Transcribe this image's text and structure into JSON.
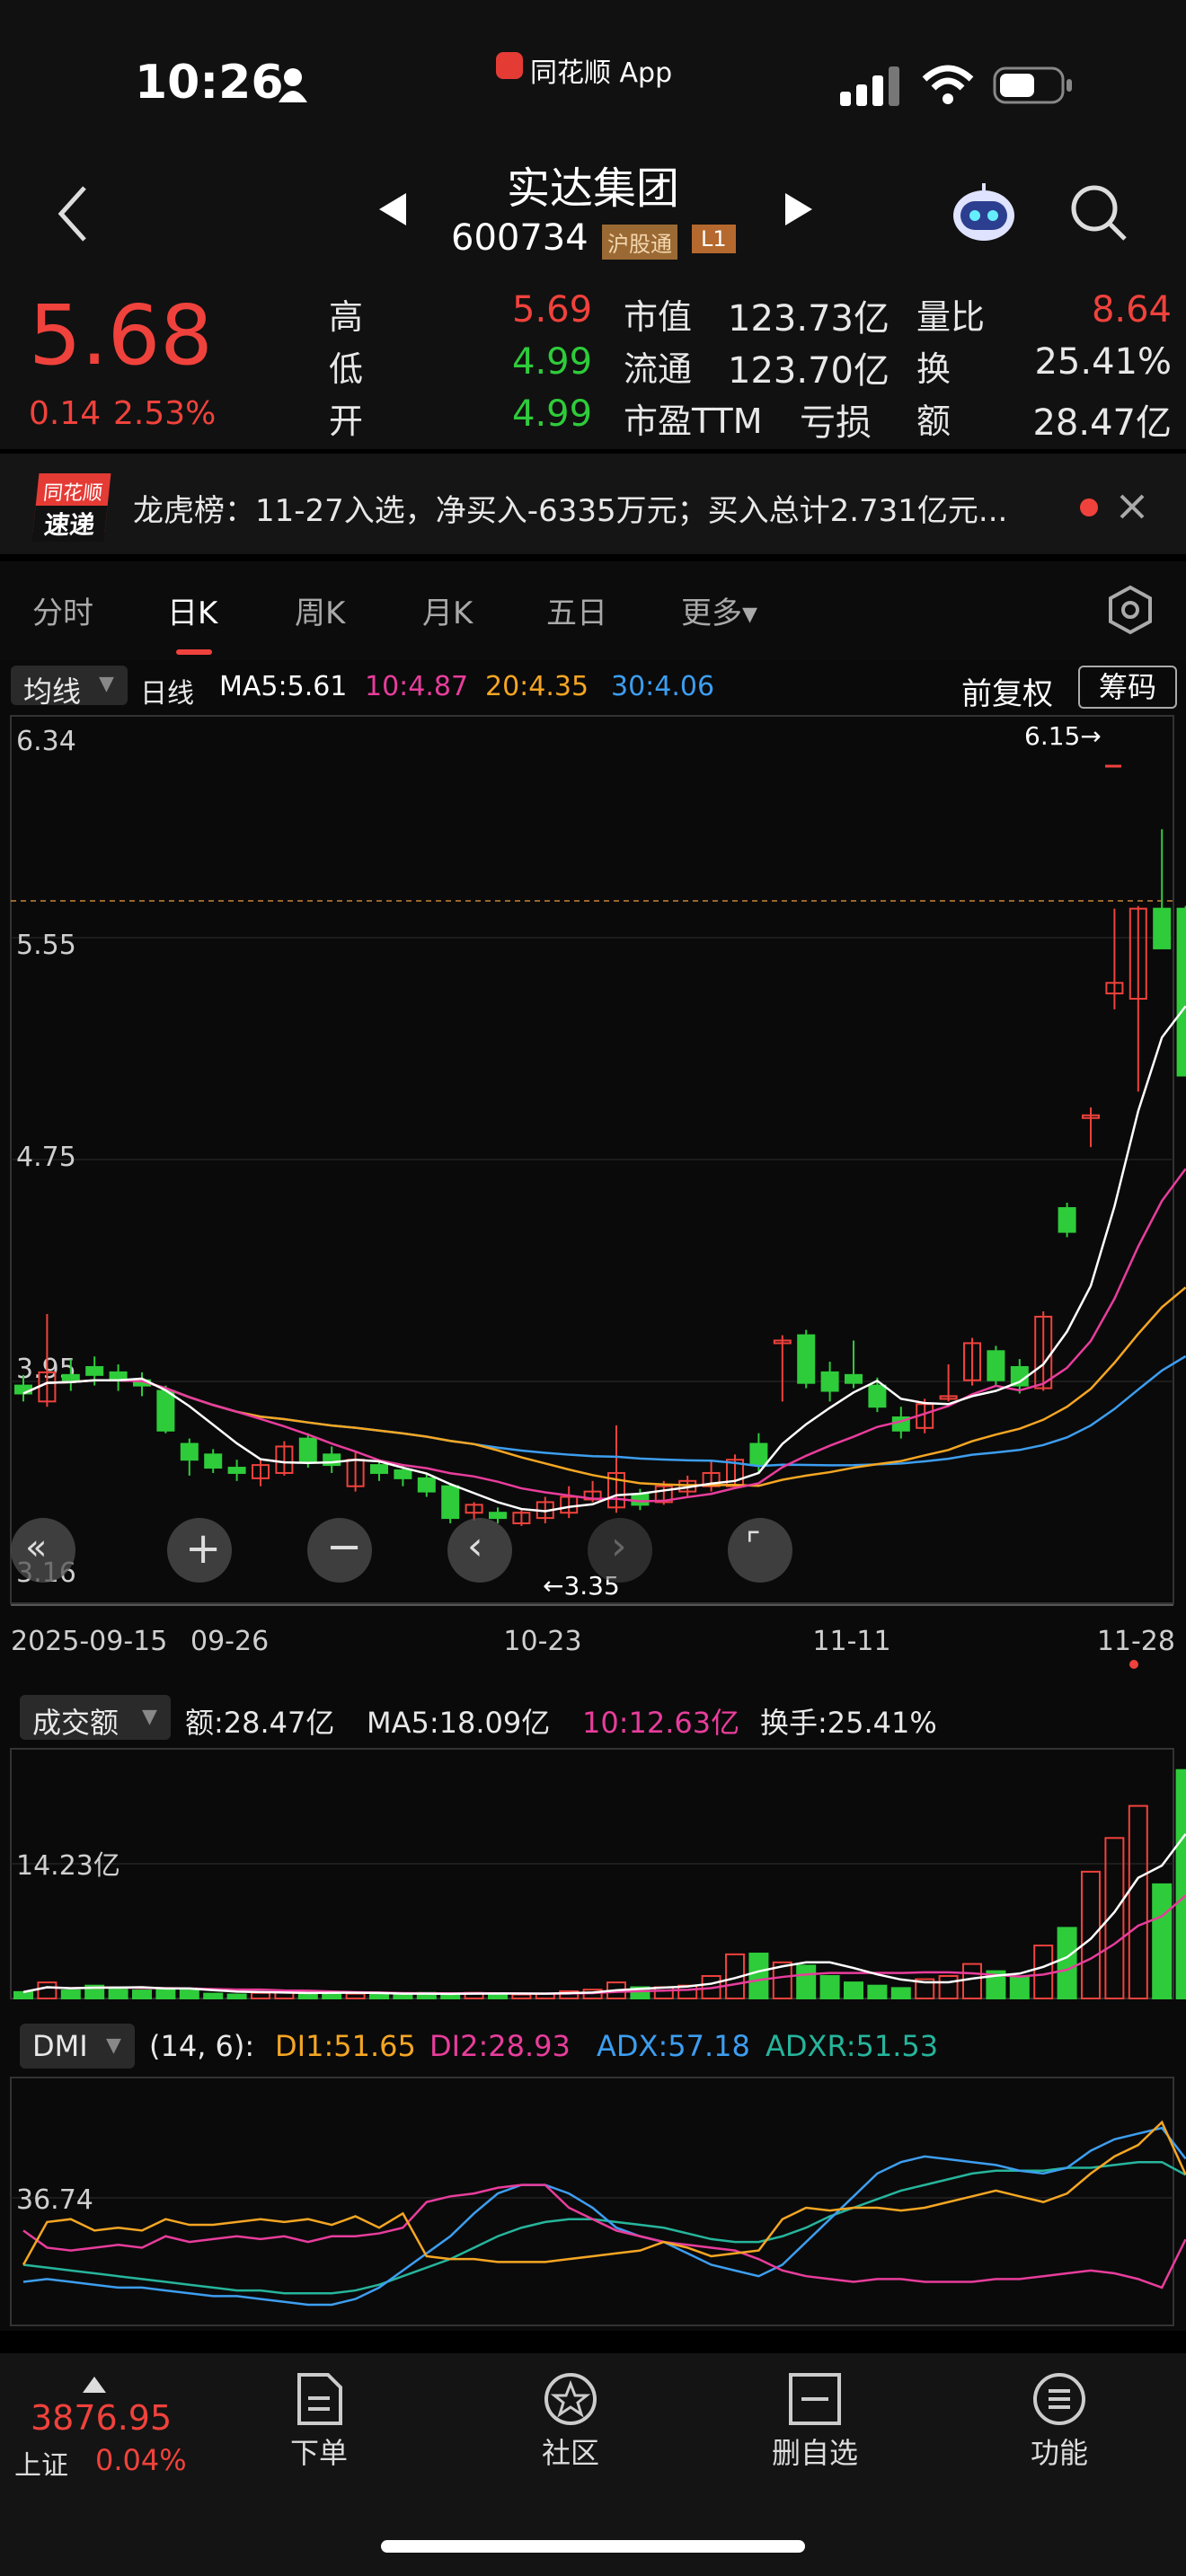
{
  "status": {
    "time": "10:26",
    "app_label": "同花顺 App"
  },
  "header": {
    "name": "实达集团",
    "code": "600734",
    "badge1": "沪股通",
    "badge2": "L1"
  },
  "quote": {
    "price": "5.68",
    "change": "0.14",
    "change_pct": "2.53%",
    "high_label": "高",
    "high": "5.69",
    "low_label": "低",
    "low": "4.99",
    "open_label": "开",
    "open": "4.99",
    "mcap_label": "市值",
    "mcap": "123.73亿",
    "float_label": "流通",
    "float": "123.70亿",
    "pe_label": "市盈TTM",
    "pe": "亏损",
    "vr_label": "量比",
    "vr": "8.64",
    "turnover_label": "换",
    "turnover": "25.41%",
    "amount_label": "额",
    "amount": "28.47亿"
  },
  "news": {
    "badge_top": "同花顺",
    "badge_bottom": "速递",
    "text": "龙虎榜：11-27入选，净买入-6335万元；买入总计2.731亿元..."
  },
  "tabs": [
    "分时",
    "日K",
    "周K",
    "月K",
    "五日",
    "更多▾"
  ],
  "kline": {
    "indicator": "均线",
    "period": "日线",
    "ma5": "MA5:5.61",
    "ma10": "10:4.87",
    "ma20": "20:4.35",
    "ma30": "30:4.06",
    "adjust": "前复权",
    "chips": "筹码",
    "y_labels": [
      "6.34",
      "5.55",
      "4.75",
      "3.95",
      "3.16"
    ],
    "high_mark": "6.15→",
    "low_mark": "←3.35",
    "dates": [
      "2025-09-15",
      "09-26",
      "10-23",
      "11-11",
      "11-28"
    ]
  },
  "volume": {
    "indicator": "成交额",
    "amount": "额:28.47亿",
    "ma5": "MA5:18.09亿",
    "ma10": "10:12.63亿",
    "turnover": "换手:25.41%",
    "y_label": "14.23亿"
  },
  "dmi": {
    "indicator": "DMI",
    "params": "(14, 6):",
    "di1": "DI1:51.65",
    "di2": "DI2:28.93",
    "adx": "ADX:57.18",
    "adxr": "ADXR:51.53",
    "y_label": "36.74"
  },
  "bottom": {
    "index_value": "3876.95",
    "index_name": "上证",
    "index_change": "0.04%",
    "items": [
      "下单",
      "社区",
      "删自选",
      "功能"
    ]
  },
  "colors": {
    "up": "#f0423c",
    "down": "#2ecc3a",
    "ma5": "#ffffff",
    "ma10": "#e83d9c",
    "ma20": "#f5a623",
    "ma30": "#3d9ef0"
  }
}
